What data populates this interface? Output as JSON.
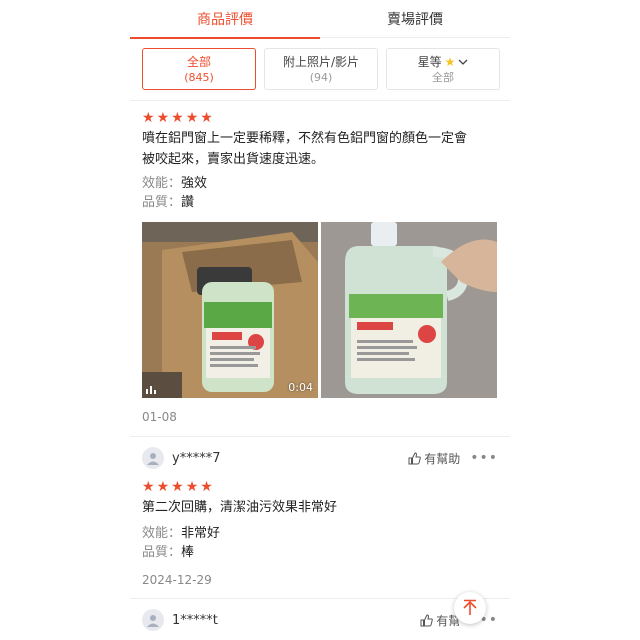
{
  "tabs": [
    {
      "label": "商品評價"
    },
    {
      "label": "賣場評價"
    }
  ],
  "filters": {
    "all": {
      "label": "全部",
      "count": "(845)"
    },
    "media": {
      "label": "附上照片/影片",
      "count": "(94)"
    },
    "rating": {
      "label": "星等",
      "sub": "全部"
    }
  },
  "reviews": [
    {
      "stars": 5,
      "comment_line1": "噴在鋁門窗上一定要稀釋，不然有色鋁門窗的顏色一定會",
      "comment_line2": "被咬起來，賣家出貨速度迅速。",
      "attr1_key": "效能：",
      "attr1_val": "強效",
      "attr2_key": "品質：",
      "attr2_val": "讚",
      "video_duration": "0:04",
      "product_label": "全能洗 K-50",
      "date": "01-08"
    },
    {
      "username": "y*****7",
      "helpful_label": "有幫助",
      "stars": 5,
      "comment": "第二次回購，清潔油污效果非常好",
      "attr1_key": "效能：",
      "attr1_val": "非常好",
      "attr2_key": "品質：",
      "attr2_val": "棒",
      "date": "2024-12-29"
    },
    {
      "username": "1*****t",
      "helpful_label": "有幫"
    }
  ],
  "colors": {
    "accent": "#ee4d2d",
    "star": "#ee4d2d",
    "muted": "#888888"
  }
}
